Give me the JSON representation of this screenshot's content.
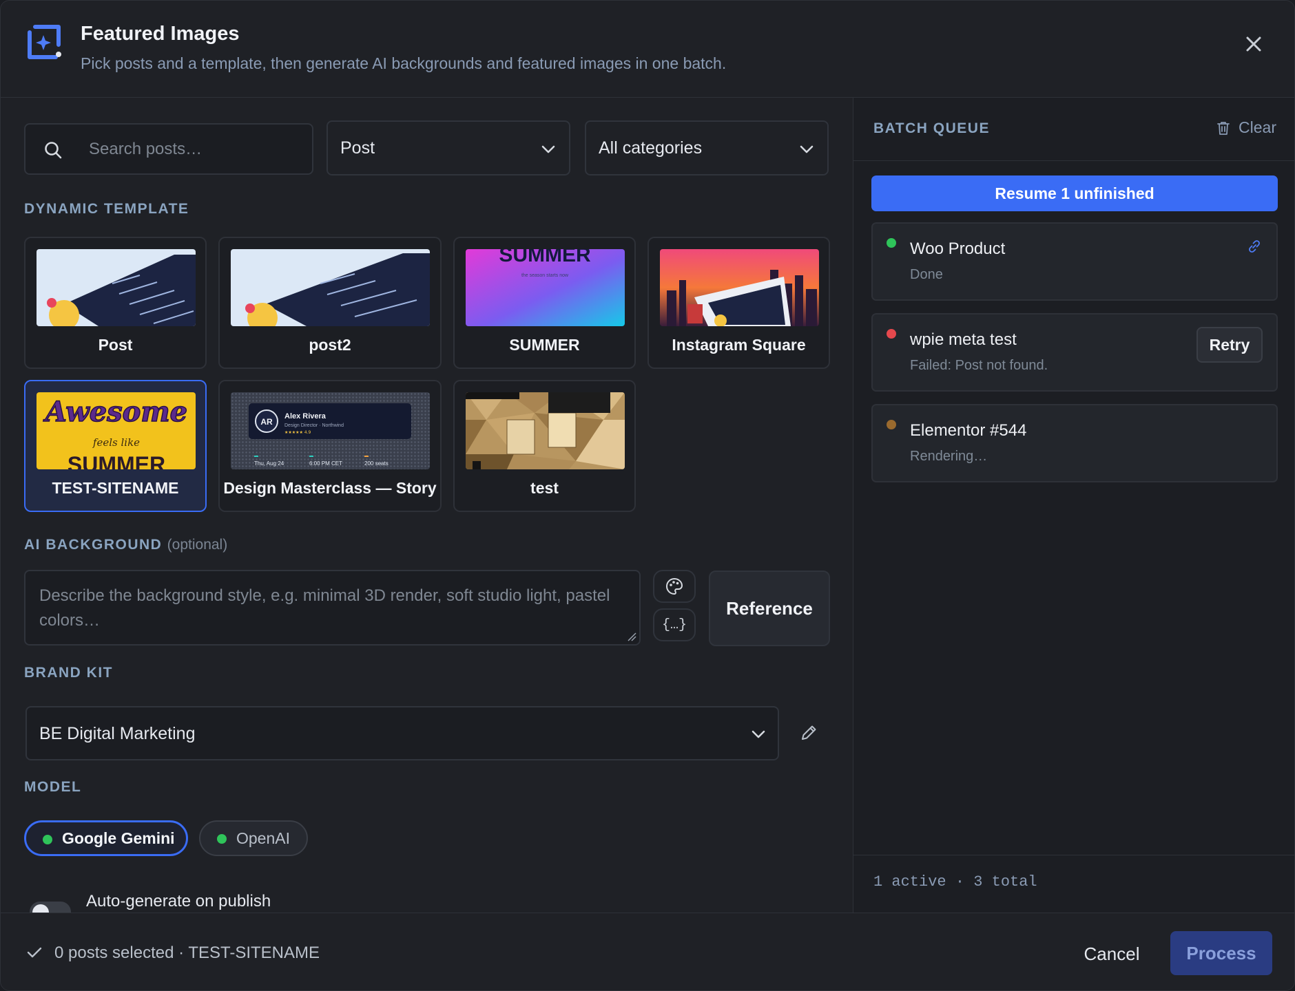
{
  "header": {
    "title": "Featured Images",
    "subtitle": "Pick posts and a template, then generate AI backgrounds and featured images in one batch."
  },
  "filters": {
    "search_placeholder": "Search posts…",
    "post_type": "Post",
    "category": "All categories"
  },
  "templates": {
    "label": "DYNAMIC TEMPLATE",
    "items": [
      {
        "name": "Post",
        "selected": false
      },
      {
        "name": "post2",
        "selected": false
      },
      {
        "name": "SUMMER",
        "selected": false
      },
      {
        "name": "Instagram Square",
        "selected": false
      },
      {
        "name": "TEST-SITENAME",
        "selected": true
      },
      {
        "name": "Design Masterclass — Story",
        "selected": false
      },
      {
        "name": "test",
        "selected": false
      }
    ],
    "thumb_text": {
      "summer_title": "SUMMER",
      "summer_sub": "the season starts now",
      "awesome": "Awesome",
      "feels_like": "feels like",
      "awesome_summer": "SUMMER",
      "ar_initials": "AR",
      "ar_name": "Alex Rivera",
      "ar_role": "Design Director · Northwind",
      "ar_rating": "★★★★★ 4.9",
      "ar_date": "Thu, Aug 24",
      "ar_time": "6:00 PM CET",
      "ar_seats": "200 seats"
    }
  },
  "ai_background": {
    "label": "AI BACKGROUND",
    "optional": "(optional)",
    "placeholder": "Describe the background style, e.g. minimal 3D render, soft studio light, pastel colors…",
    "variables_label": "{…}",
    "reference_label": "Reference"
  },
  "brand_kit": {
    "label": "BRAND KIT",
    "value": "BE Digital Marketing"
  },
  "model": {
    "label": "MODEL",
    "options": [
      {
        "name": "Google Gemini",
        "active": true
      },
      {
        "name": "OpenAI",
        "active": false
      }
    ]
  },
  "auto_generate": {
    "label": "Auto-generate on publish",
    "enabled": false
  },
  "queue": {
    "title": "BATCH QUEUE",
    "clear_label": "Clear",
    "resume_label": "Resume 1 unfinished",
    "items": [
      {
        "name": "Woo Product",
        "status": "Done",
        "dot_color": "#2fc45a"
      },
      {
        "name": "wpie meta test",
        "status": "Failed: Post not found.",
        "dot_color": "#e5484d",
        "action": "Retry"
      },
      {
        "name": "Elementor #544",
        "status": "Rendering…",
        "dot_color": "#9a6a2e"
      }
    ],
    "summary": "1 active · 3 total"
  },
  "footer": {
    "status": "0 posts selected · TEST-SITENAME",
    "cancel_label": "Cancel",
    "process_label": "Process"
  },
  "colors": {
    "accent": "#3a6cf5",
    "success": "#2fc45a",
    "error": "#e5484d",
    "pending": "#9a6a2e"
  }
}
